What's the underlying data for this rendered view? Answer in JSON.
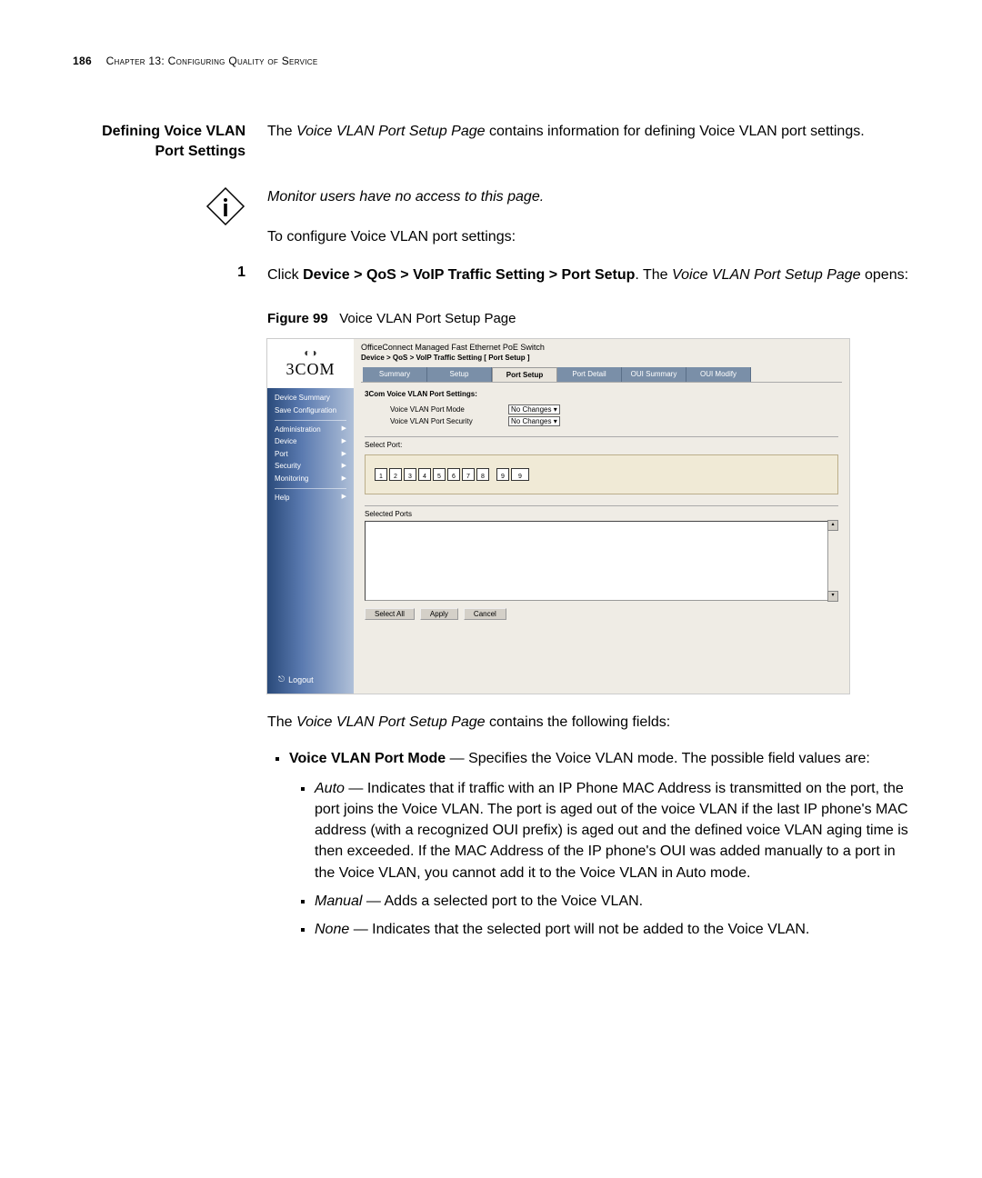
{
  "header": {
    "page_number": "186",
    "chapter_label": "Chapter 13: Configuring Quality of Service"
  },
  "section": {
    "title_line1": "Defining Voice VLAN",
    "title_line2": "Port Settings",
    "intro_part1": "The ",
    "intro_italic": "Voice VLAN Port Setup Page",
    "intro_part2": " contains information for defining Voice VLAN port settings."
  },
  "note": {
    "italic_text": "Monitor users have no access to this page.",
    "following": "To configure Voice VLAN port settings:"
  },
  "step1": {
    "num": "1",
    "pre": "Click ",
    "bold_path": "Device > QoS > VoIP Traffic Setting > Port Setup",
    "post1": ". The ",
    "italic_page": "Voice VLAN Port Setup Page",
    "post2": " opens:"
  },
  "figure": {
    "label": "Figure 99",
    "caption": "Voice VLAN Port Setup Page"
  },
  "screenshot": {
    "logo_brand": "3COM",
    "product_title": "OfficeConnect Managed Fast Ethernet PoE Switch",
    "breadcrumb": "Device > QoS > VoIP Traffic Setting [ Port Setup ]",
    "sidebar": {
      "device_summary": "Device Summary",
      "save_config": "Save Configuration",
      "administration": "Administration",
      "device": "Device",
      "port": "Port",
      "security": "Security",
      "monitoring": "Monitoring",
      "help": "Help",
      "logout": "Logout"
    },
    "tabs": {
      "summary": "Summary",
      "setup": "Setup",
      "port_setup": "Port Setup",
      "port_detail": "Port Detail",
      "oui_summary": "OUI Summary",
      "oui_modify": "OUI Modify"
    },
    "panel_title": "3Com Voice VLAN Port Settings:",
    "fields": {
      "mode_label": "Voice VLAN Port Mode",
      "mode_value": "No Changes",
      "security_label": "Voice VLAN Port Security",
      "security_value": "No Changes"
    },
    "select_port_label": "Select Port:",
    "ports": [
      "1",
      "2",
      "3",
      "4",
      "5",
      "6",
      "7",
      "8",
      "9",
      "9"
    ],
    "selected_ports_label": "Selected Ports",
    "buttons": {
      "select_all": "Select All",
      "apply": "Apply",
      "cancel": "Cancel"
    }
  },
  "after": {
    "lead_pre": "The ",
    "lead_italic": "Voice VLAN Port Setup Page",
    "lead_post": " contains the following fields:",
    "field_mode_bold": "Voice VLAN Port Mode",
    "field_mode_rest": " — Specifies the Voice VLAN mode. The possible field values are:",
    "auto_italic": "Auto",
    "auto_rest": " — Indicates that if traffic with an IP Phone MAC Address is transmitted on the port, the port joins the Voice VLAN. The port is aged out of the voice VLAN if the last IP phone's MAC address (with a recognized OUI prefix) is aged out and the defined voice VLAN aging time is then exceeded. If the MAC Address of the IP phone's OUI was added manually to a port in the Voice VLAN, you cannot add it to the Voice VLAN in Auto mode.",
    "manual_italic": "Manual",
    "manual_rest": " — Adds a selected port to the Voice VLAN.",
    "none_italic": "None",
    "none_rest": " — Indicates that the selected port will not be added to the Voice VLAN."
  }
}
